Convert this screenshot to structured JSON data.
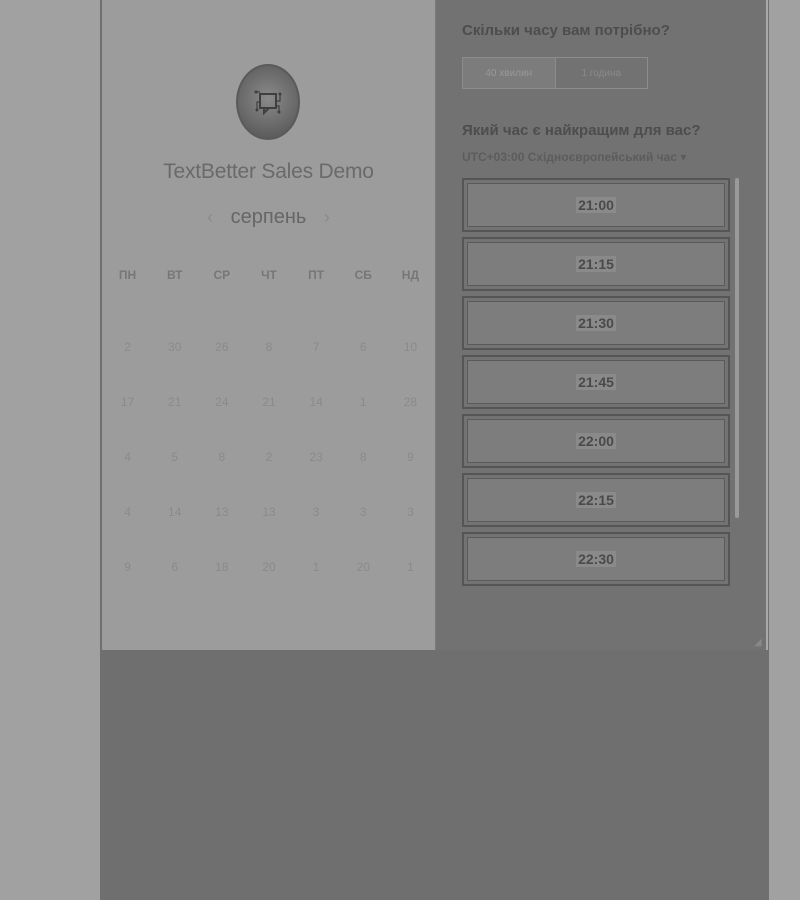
{
  "left": {
    "title": "TextBetter Sales Demo",
    "month": "серпень",
    "prev_icon": "‹",
    "next_icon": "›",
    "weekdays": [
      "ПН",
      "ВТ",
      "СР",
      "ЧТ",
      "ПТ",
      "СБ",
      "НД"
    ],
    "days": [
      "2",
      "30",
      "26",
      "8",
      "7",
      "6",
      "10",
      "17",
      "21",
      "24",
      "21",
      "14",
      "1",
      "28",
      "4",
      "5",
      "8",
      "2",
      "23",
      "8",
      "9",
      "4",
      "14",
      "13",
      "13",
      "3",
      "3",
      "3",
      "9",
      "6",
      "18",
      "20",
      "1",
      "20",
      "1"
    ]
  },
  "right": {
    "duration_question": "Скільки часу вам потрібно?",
    "duration_options": [
      "40 хвилин",
      "1 година"
    ],
    "time_question": "Який час є найкращим для вас?",
    "timezone": "UTC+03:00 Східноєвропейський час ▾",
    "slots": [
      "21:00",
      "21:15",
      "21:30",
      "21:45",
      "22:00",
      "22:15",
      "22:30"
    ]
  },
  "colors": {
    "background": "#a1a1a1",
    "left_panel": "#9c9c9c",
    "right_panel": "#727272"
  },
  "icons": {
    "logo": "textbetter-logo-icon",
    "resize": "resize-handle-icon"
  }
}
